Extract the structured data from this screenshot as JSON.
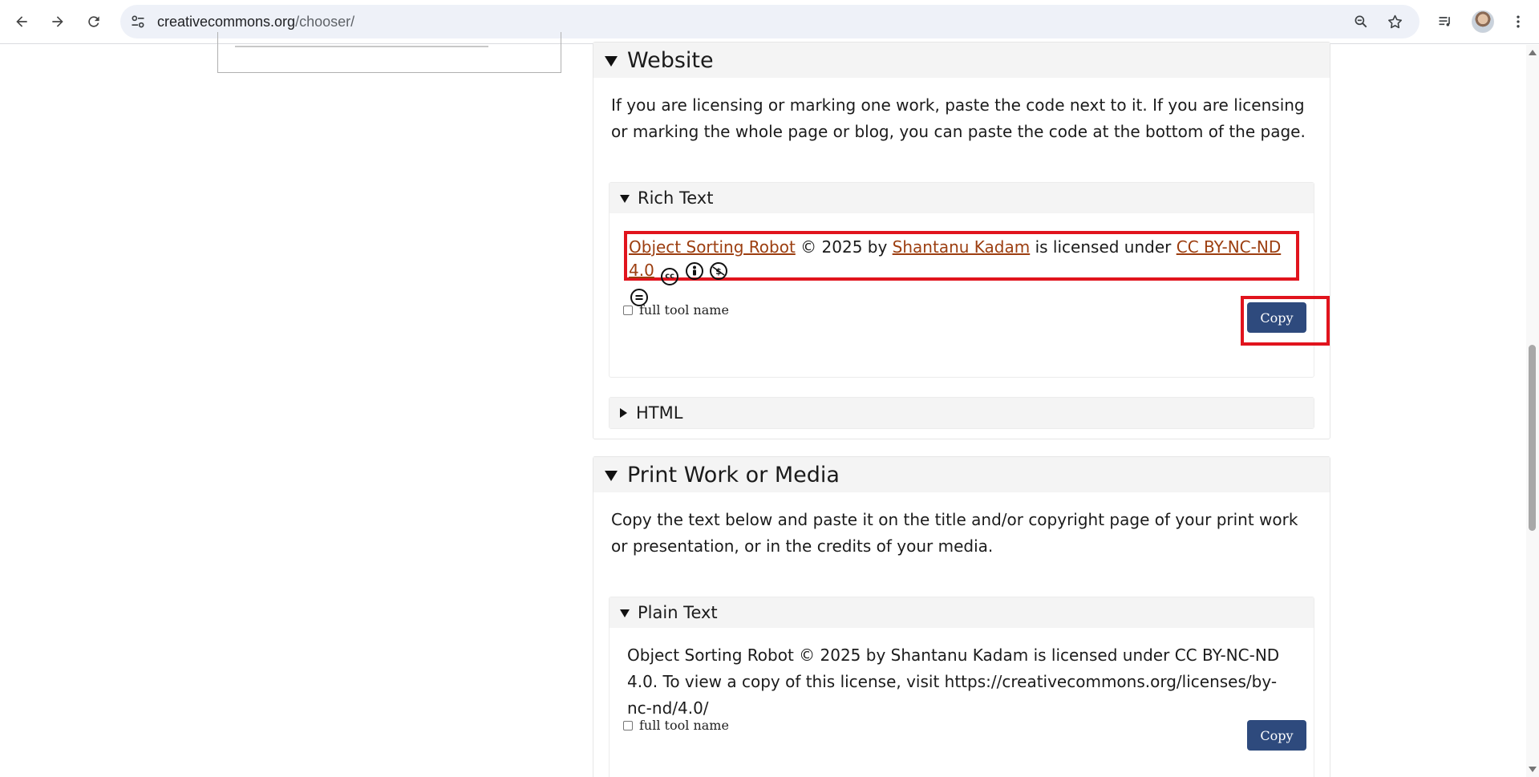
{
  "browser": {
    "url_host": "creativecommons.org",
    "url_path": "/chooser/"
  },
  "website": {
    "title": "Website",
    "description": "If you are licensing or marking one work, paste the code next to it. If you are licensing or marking the whole page or blog, you can paste the code at the bottom of the page.",
    "rich_text": {
      "title": "Rich Text",
      "work_title": "Object Sorting Robot",
      "copyright": "© 2025 by",
      "author": "Shantanu Kadam",
      "licensed_under": "is licensed under",
      "license": "CC BY-NC-ND 4.0",
      "icons": [
        "cc-icon",
        "by-icon",
        "nc-icon",
        "nd-icon"
      ],
      "checkbox_label": "full tool name",
      "copy_label": "Copy"
    },
    "html": {
      "title": "HTML"
    }
  },
  "print": {
    "title": "Print Work or Media",
    "description": "Copy the text below and paste it on the title and/or copyright page of your print work or presentation, or in the credits of your media.",
    "plain_text": {
      "title": "Plain Text",
      "text": "Object Sorting Robot © 2025 by Shantanu Kadam is licensed under CC BY-NC-ND 4.0. To view a copy of this license, visit https://creativecommons.org/licenses/by-nc-nd/4.0/",
      "checkbox_label": "full tool name",
      "copy_label": "Copy"
    }
  },
  "colors": {
    "copy_button": "#2e4a7d",
    "highlight": "#e1141d",
    "link": "#9c3e10"
  }
}
